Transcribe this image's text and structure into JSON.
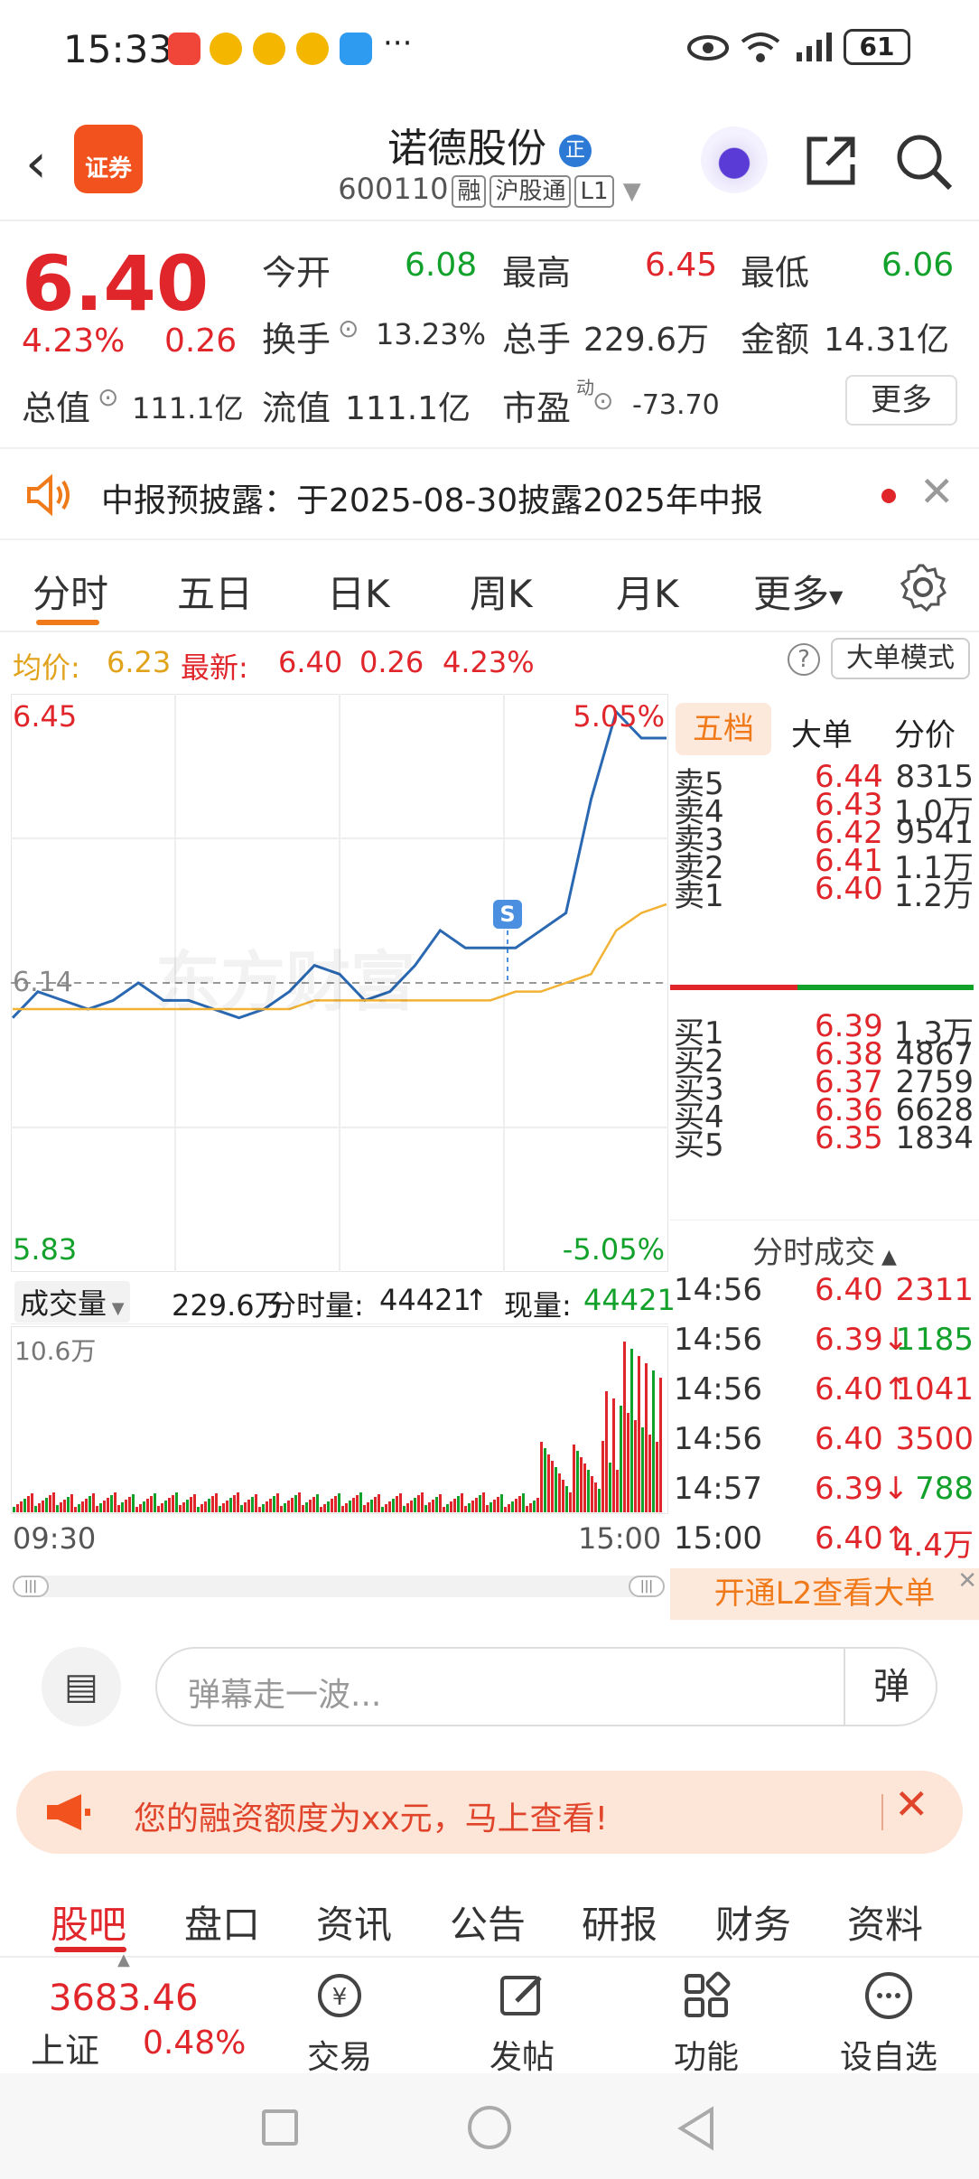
{
  "status_bar": {
    "time": "15:33",
    "more": "···",
    "battery": "61"
  },
  "header": {
    "logo_text": "证券",
    "stock_name": "诺德股份",
    "name_badge": "正",
    "code": "600110",
    "tags": [
      "融",
      "沪股通",
      "L1"
    ]
  },
  "quote": {
    "price": "6.40",
    "change_pct": "4.23%",
    "change": "0.26",
    "open_label": "今开",
    "open": "6.08",
    "high_label": "最高",
    "high": "6.45",
    "low_label": "最低",
    "low": "6.06",
    "turnover_label": "换手",
    "turnover": "13.23%",
    "volume_label": "总手",
    "volume": "229.6万",
    "amount_label": "金额",
    "amount": "14.31亿",
    "mktcap_label": "总值",
    "mktcap": "111.1亿",
    "float_label": "流值",
    "float": "111.1亿",
    "pe_label": "市盈",
    "pe_sup": "动",
    "pe": "-73.70",
    "more_label": "更多"
  },
  "notice": {
    "text": "中报预披露：于2025-08-30披露2025年中报"
  },
  "tabs": [
    "分时",
    "五日",
    "日K",
    "周K",
    "月K",
    "更多"
  ],
  "summary": {
    "avg_label": "均价:",
    "avg": "6.23",
    "latest_label": "最新:",
    "latest": "6.40",
    "chg": "0.26",
    "pct": "4.23%",
    "mode_label": "大单模式"
  },
  "chart": {
    "y_top": "6.45",
    "y_bottom": "5.83",
    "pct_top": "5.05%",
    "pct_bottom": "-5.05%",
    "prev_close": "6.14",
    "marker": "S",
    "watermark": "东方财富",
    "volume_label": "成交量",
    "volume_total": "229.6万",
    "period_label": "分时量:",
    "period_val": "44421",
    "period_arrow": "↑",
    "now_label": "现量:",
    "now_val": "44421",
    "vol_max": "10.6万",
    "t_start": "09:30",
    "t_end": "15:00"
  },
  "chart_data": {
    "type": "line",
    "series": [
      {
        "name": "price",
        "values": [
          6.1,
          6.13,
          6.12,
          6.11,
          6.12,
          6.14,
          6.12,
          6.12,
          6.11,
          6.1,
          6.11,
          6.13,
          6.16,
          6.15,
          6.12,
          6.13,
          6.16,
          6.2,
          6.18,
          6.18,
          6.18,
          6.2,
          6.22,
          6.35,
          6.45,
          6.42,
          6.42
        ]
      },
      {
        "name": "avg",
        "values": [
          6.11,
          6.11,
          6.11,
          6.11,
          6.11,
          6.11,
          6.11,
          6.11,
          6.11,
          6.11,
          6.11,
          6.11,
          6.12,
          6.12,
          6.12,
          6.12,
          6.12,
          6.12,
          6.12,
          6.12,
          6.13,
          6.13,
          6.14,
          6.15,
          6.2,
          6.22,
          6.23
        ]
      }
    ],
    "ylim": [
      5.83,
      6.45
    ]
  },
  "orderbook": {
    "tabs": [
      "五档",
      "大单",
      "分价"
    ],
    "asks": [
      [
        "卖5",
        "6.44",
        "8315"
      ],
      [
        "卖4",
        "6.43",
        "1.0万"
      ],
      [
        "卖3",
        "6.42",
        "9541"
      ],
      [
        "卖2",
        "6.41",
        "1.1万"
      ],
      [
        "卖1",
        "6.40",
        "1.2万"
      ]
    ],
    "bids": [
      [
        "买1",
        "6.39",
        "1.3万"
      ],
      [
        "买2",
        "6.38",
        "4867"
      ],
      [
        "买3",
        "6.37",
        "2759"
      ],
      [
        "买4",
        "6.36",
        "6628"
      ],
      [
        "买5",
        "6.35",
        "1834"
      ]
    ],
    "trades_title": "分时成交",
    "trades": [
      [
        "14:56",
        "6.40",
        "2311"
      ],
      [
        "14:56",
        "6.39↓",
        "1185"
      ],
      [
        "14:56",
        "6.40↑",
        "1041"
      ],
      [
        "14:56",
        "6.40",
        "3500"
      ],
      [
        "14:57",
        "6.39↓",
        "788"
      ],
      [
        "15:00",
        "6.40↑",
        "4.4万"
      ]
    ],
    "l2_banner": "开通L2查看大单"
  },
  "comment": {
    "placeholder": "弹幕走一波...",
    "send": "弹"
  },
  "ad": {
    "text": "您的融资额度为xx元，马上查看!"
  },
  "bar_tabs": [
    "股吧",
    "盘口",
    "资讯",
    "公告",
    "研报",
    "财务",
    "资料"
  ],
  "bottom": {
    "index_value": "3683.46",
    "index_name": "上证",
    "index_pct": "0.48%",
    "items": [
      "交易",
      "发帖",
      "功能",
      "设自选"
    ]
  },
  "colors": {
    "up": "#e0252b",
    "down": "#12a12a",
    "accent": "#f07a1a",
    "avg_line": "#f2b233",
    "price_line": "#2a68b2"
  }
}
